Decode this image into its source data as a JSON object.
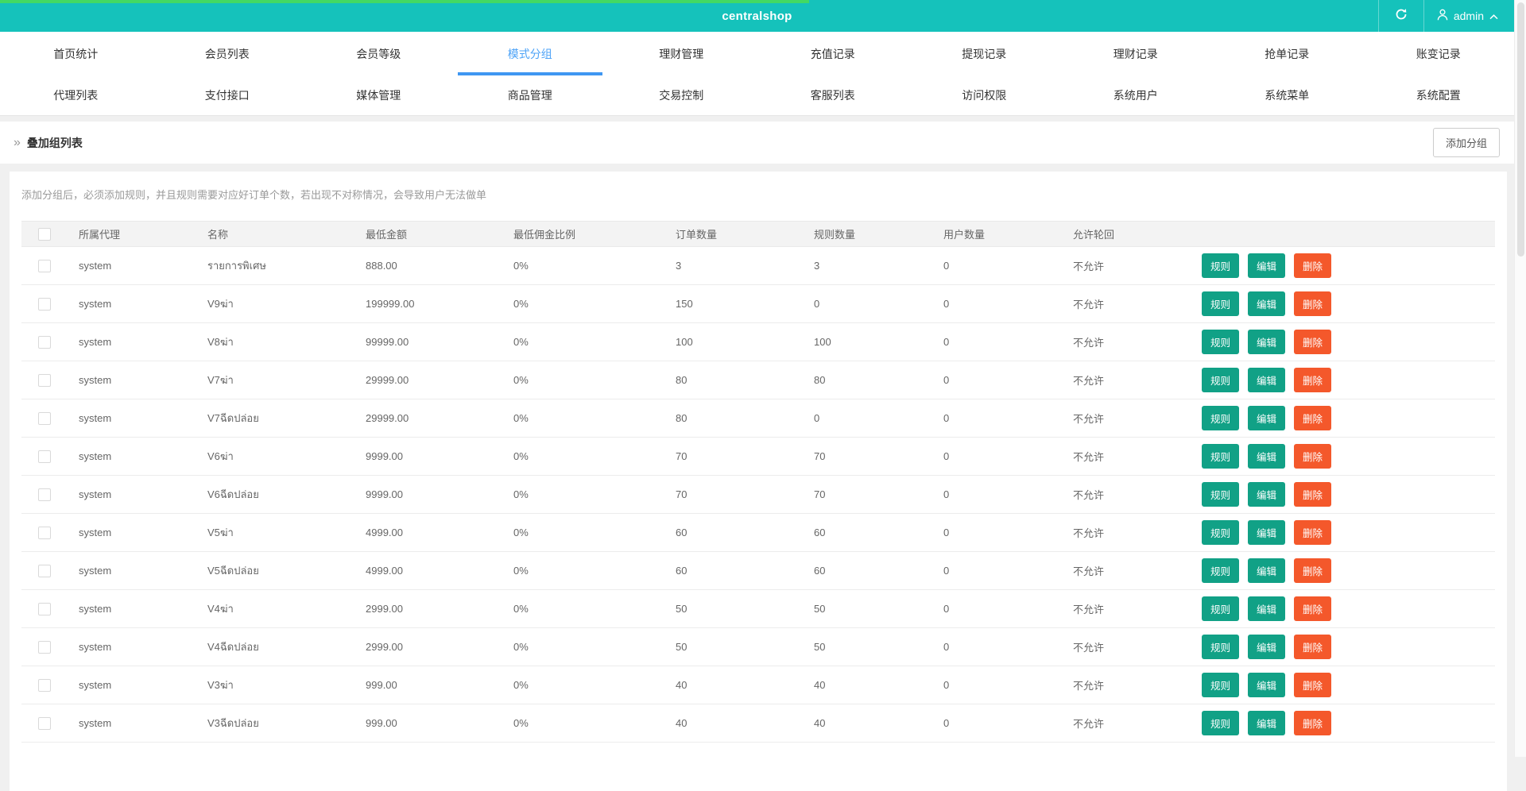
{
  "colors": {
    "header_teal": "#15c2bb",
    "progress_green": "#43d963",
    "active_blue": "#4da3f7",
    "underline_blue": "#3f97f2",
    "page_bg": "#f0f0f0",
    "button_teal": "#11a186",
    "button_orange": "#f4582b"
  },
  "progress": {
    "percent": 53
  },
  "header": {
    "title": "centralshop",
    "user": "admin",
    "refresh_icon": "refresh",
    "user_icon": "user-silhouette",
    "caret_icon": "chevron-up"
  },
  "nav": {
    "active": "模式分组",
    "row1": [
      "首页统计",
      "会员列表",
      "会员等级",
      "模式分组",
      "理财管理",
      "充值记录",
      "提现记录",
      "理财记录",
      "抢单记录",
      "账变记录"
    ],
    "row2": [
      "代理列表",
      "支付接口",
      "媒体管理",
      "商品管理",
      "交易控制",
      "客服列表",
      "访问权限",
      "系统用户",
      "系统菜单",
      "系统配置"
    ]
  },
  "breadcrumb": {
    "icon": "»",
    "title": "叠加组列表"
  },
  "toolbar": {
    "add_group_label": "添加分组"
  },
  "notice": "添加分组后，必须添加规则，并且规则需要对应好订单个数，若出现不对称情况，会导致用户无法做单",
  "table": {
    "columns": [
      "所属代理",
      "名称",
      "最低金额",
      "最低佣金比例",
      "订单数量",
      "规则数量",
      "用户数量",
      "允许轮回"
    ],
    "actions": [
      "规则",
      "编辑",
      "删除"
    ],
    "rows": [
      {
        "agent": "system",
        "name": "รายการพิเศษ",
        "min_amount": "888.00",
        "min_commission": "0%",
        "orders": "3",
        "rules": "3",
        "users": "0",
        "recycle": "不允许"
      },
      {
        "agent": "system",
        "name": "V9ฆ่า",
        "min_amount": "199999.00",
        "min_commission": "0%",
        "orders": "150",
        "rules": "0",
        "users": "0",
        "recycle": "不允许"
      },
      {
        "agent": "system",
        "name": "V8ฆ่า",
        "min_amount": "99999.00",
        "min_commission": "0%",
        "orders": "100",
        "rules": "100",
        "users": "0",
        "recycle": "不允许"
      },
      {
        "agent": "system",
        "name": "V7ฆ่า",
        "min_amount": "29999.00",
        "min_commission": "0%",
        "orders": "80",
        "rules": "80",
        "users": "0",
        "recycle": "不允许"
      },
      {
        "agent": "system",
        "name": "V7ฉีดปล่อย",
        "min_amount": "29999.00",
        "min_commission": "0%",
        "orders": "80",
        "rules": "0",
        "users": "0",
        "recycle": "不允许"
      },
      {
        "agent": "system",
        "name": "V6ฆ่า",
        "min_amount": "9999.00",
        "min_commission": "0%",
        "orders": "70",
        "rules": "70",
        "users": "0",
        "recycle": "不允许"
      },
      {
        "agent": "system",
        "name": "V6ฉีดปล่อย",
        "min_amount": "9999.00",
        "min_commission": "0%",
        "orders": "70",
        "rules": "70",
        "users": "0",
        "recycle": "不允许"
      },
      {
        "agent": "system",
        "name": "V5ฆ่า",
        "min_amount": "4999.00",
        "min_commission": "0%",
        "orders": "60",
        "rules": "60",
        "users": "0",
        "recycle": "不允许"
      },
      {
        "agent": "system",
        "name": "V5ฉีดปล่อย",
        "min_amount": "4999.00",
        "min_commission": "0%",
        "orders": "60",
        "rules": "60",
        "users": "0",
        "recycle": "不允许"
      },
      {
        "agent": "system",
        "name": "V4ฆ่า",
        "min_amount": "2999.00",
        "min_commission": "0%",
        "orders": "50",
        "rules": "50",
        "users": "0",
        "recycle": "不允许"
      },
      {
        "agent": "system",
        "name": "V4ฉีดปล่อย",
        "min_amount": "2999.00",
        "min_commission": "0%",
        "orders": "50",
        "rules": "50",
        "users": "0",
        "recycle": "不允许"
      },
      {
        "agent": "system",
        "name": "V3ฆ่า",
        "min_amount": "999.00",
        "min_commission": "0%",
        "orders": "40",
        "rules": "40",
        "users": "0",
        "recycle": "不允许"
      },
      {
        "agent": "system",
        "name": "V3ฉีดปล่อย",
        "min_amount": "999.00",
        "min_commission": "0%",
        "orders": "40",
        "rules": "40",
        "users": "0",
        "recycle": "不允许"
      }
    ]
  }
}
